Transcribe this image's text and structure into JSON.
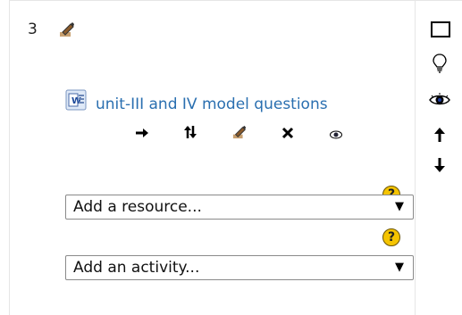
{
  "section": {
    "number": "3"
  },
  "resource": {
    "link_text": "unit-III and IV model questions",
    "file_type_icon": "word-document-icon",
    "actions": [
      "move-right-icon",
      "move-icon",
      "edit-icon",
      "delete-icon",
      "show-icon"
    ]
  },
  "add_resource": {
    "selected": "Add a resource...",
    "help": "?"
  },
  "add_activity": {
    "selected": "Add an activity...",
    "help": "?"
  },
  "section_controls": [
    "select-checkbox-icon",
    "highlight-bulb-icon",
    "visibility-eye-icon",
    "move-up-icon",
    "move-down-icon"
  ],
  "colors": {
    "link": "#2a6fb0",
    "help_badge": "#f5c400",
    "border": "#e6e6e6"
  }
}
